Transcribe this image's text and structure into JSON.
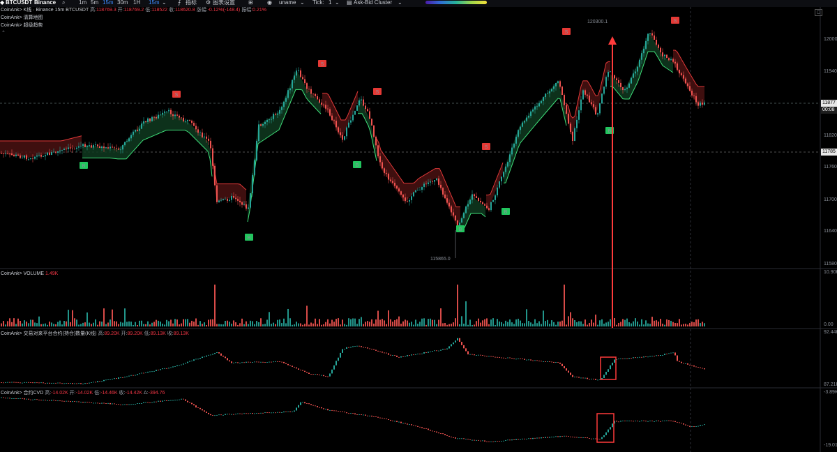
{
  "toolbar": {
    "symbol": "BTCUSDT",
    "exchange": "Binance",
    "intervals": [
      "1m",
      "5m",
      "15m",
      "30m",
      "1H"
    ],
    "active_interval": "15m",
    "indicators_label": "指标",
    "chart_settings_label": "图表设置",
    "user_label": "uname",
    "tick_label": "Tick:",
    "tick_value": "1",
    "cluster_label": "Ask-Bid Cluster"
  },
  "legend_main": {
    "prefix": "CoinAnk> K线 · Binance 15m BTCUSDT",
    "high_label": "高:",
    "high": "118769.3",
    "open_label": "开:",
    "open": "118769.2",
    "low_label": "低:",
    "low": "118522",
    "close_label": "收:",
    "close": "118620.8",
    "change_label": "涨幅:",
    "change": "-0.12%(-148.4)",
    "amp_label": "振幅:",
    "amp": "0.21%",
    "sub1": "CoinAnk> 清算地图",
    "sub2": "CoinAnk> 超级趋势"
  },
  "legend_volume": {
    "label": "CoinAnk> VOLUME",
    "value": "1.49K"
  },
  "legend_oi": {
    "label": "CoinAnk> 交易对来平台合约(持仓)数量(K线)",
    "high_label": "高:",
    "high": "89.20K",
    "open_label": "开:",
    "open": "89.20K",
    "low_label": "低:",
    "low": "89.13K",
    "close_label": "收:",
    "close": "89.13K"
  },
  "legend_cvd": {
    "label": "CoinAnk> 合约CVD",
    "high_label": "高:",
    "high": "-14.02K",
    "open_label": "开:",
    "open": "-14.02K",
    "low_label": "低:",
    "low": "-14.46K",
    "close_label": "收:",
    "close": "-14.42K",
    "delta_label": "Δ:",
    "delta": "-394.76"
  },
  "price_axis": [
    "12000",
    "11940",
    "11877",
    "11820",
    "11785",
    "11760",
    "11700",
    "11640",
    "11580"
  ],
  "price_tags": {
    "current": "11877",
    "countdown": "00:08",
    "ref": "11785"
  },
  "volume_axis": [
    "10.90K",
    "0.00"
  ],
  "oi_axis": [
    "92.44K",
    "87.21K"
  ],
  "cvd_axis": [
    "-3.89K",
    "-19.01K"
  ],
  "annotations": {
    "high_mark": "120300.1",
    "low_mark": "115865.0"
  },
  "signals": {
    "buy": "B",
    "sell": "S"
  },
  "colors": {
    "up": "#26a69a",
    "down": "#ef5350",
    "bull_fill": "#0f3a20",
    "bear_fill": "#4a1212",
    "highlight": "#ff3b3b"
  }
}
